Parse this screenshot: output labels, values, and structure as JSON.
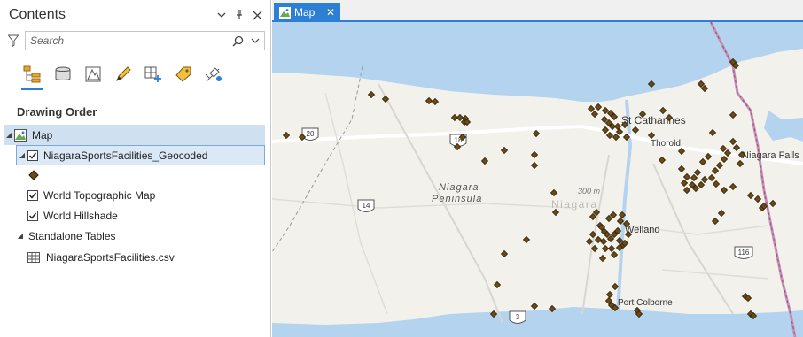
{
  "contents_pane": {
    "title": "Contents",
    "search_placeholder": "Search",
    "drawing_order_heading": "Drawing Order",
    "map_node": "Map",
    "layers": [
      {
        "label": "NiagaraSportsFacilities_Geocoded",
        "checked": true,
        "selected": true
      },
      {
        "label": "World Topographic Map",
        "checked": true
      },
      {
        "label": "World Hillshade",
        "checked": true
      }
    ],
    "standalone_heading": "Standalone Tables",
    "table_item": "NiagaraSportsFacilities.csv"
  },
  "map_view": {
    "tab_label": "Map",
    "place_labels": {
      "st_catharines": "St Catharines",
      "thorold": "Thorold",
      "niagara_falls": "Niagara Falls",
      "niagara_peninsula_line1": "Niagara",
      "niagara_peninsula_line2": "Peninsula",
      "niagara_region": "Niagara",
      "elevation": "300 m",
      "welland": "Welland",
      "port_colborne": "Port Colborne"
    },
    "highway_shields": [
      "20",
      "18",
      "14",
      "3",
      "116"
    ],
    "colors": {
      "water": "#b3d3ef",
      "land": "#f2f1ec",
      "point_fill": "#6b4a15",
      "accent": "#2d7fd3"
    }
  }
}
